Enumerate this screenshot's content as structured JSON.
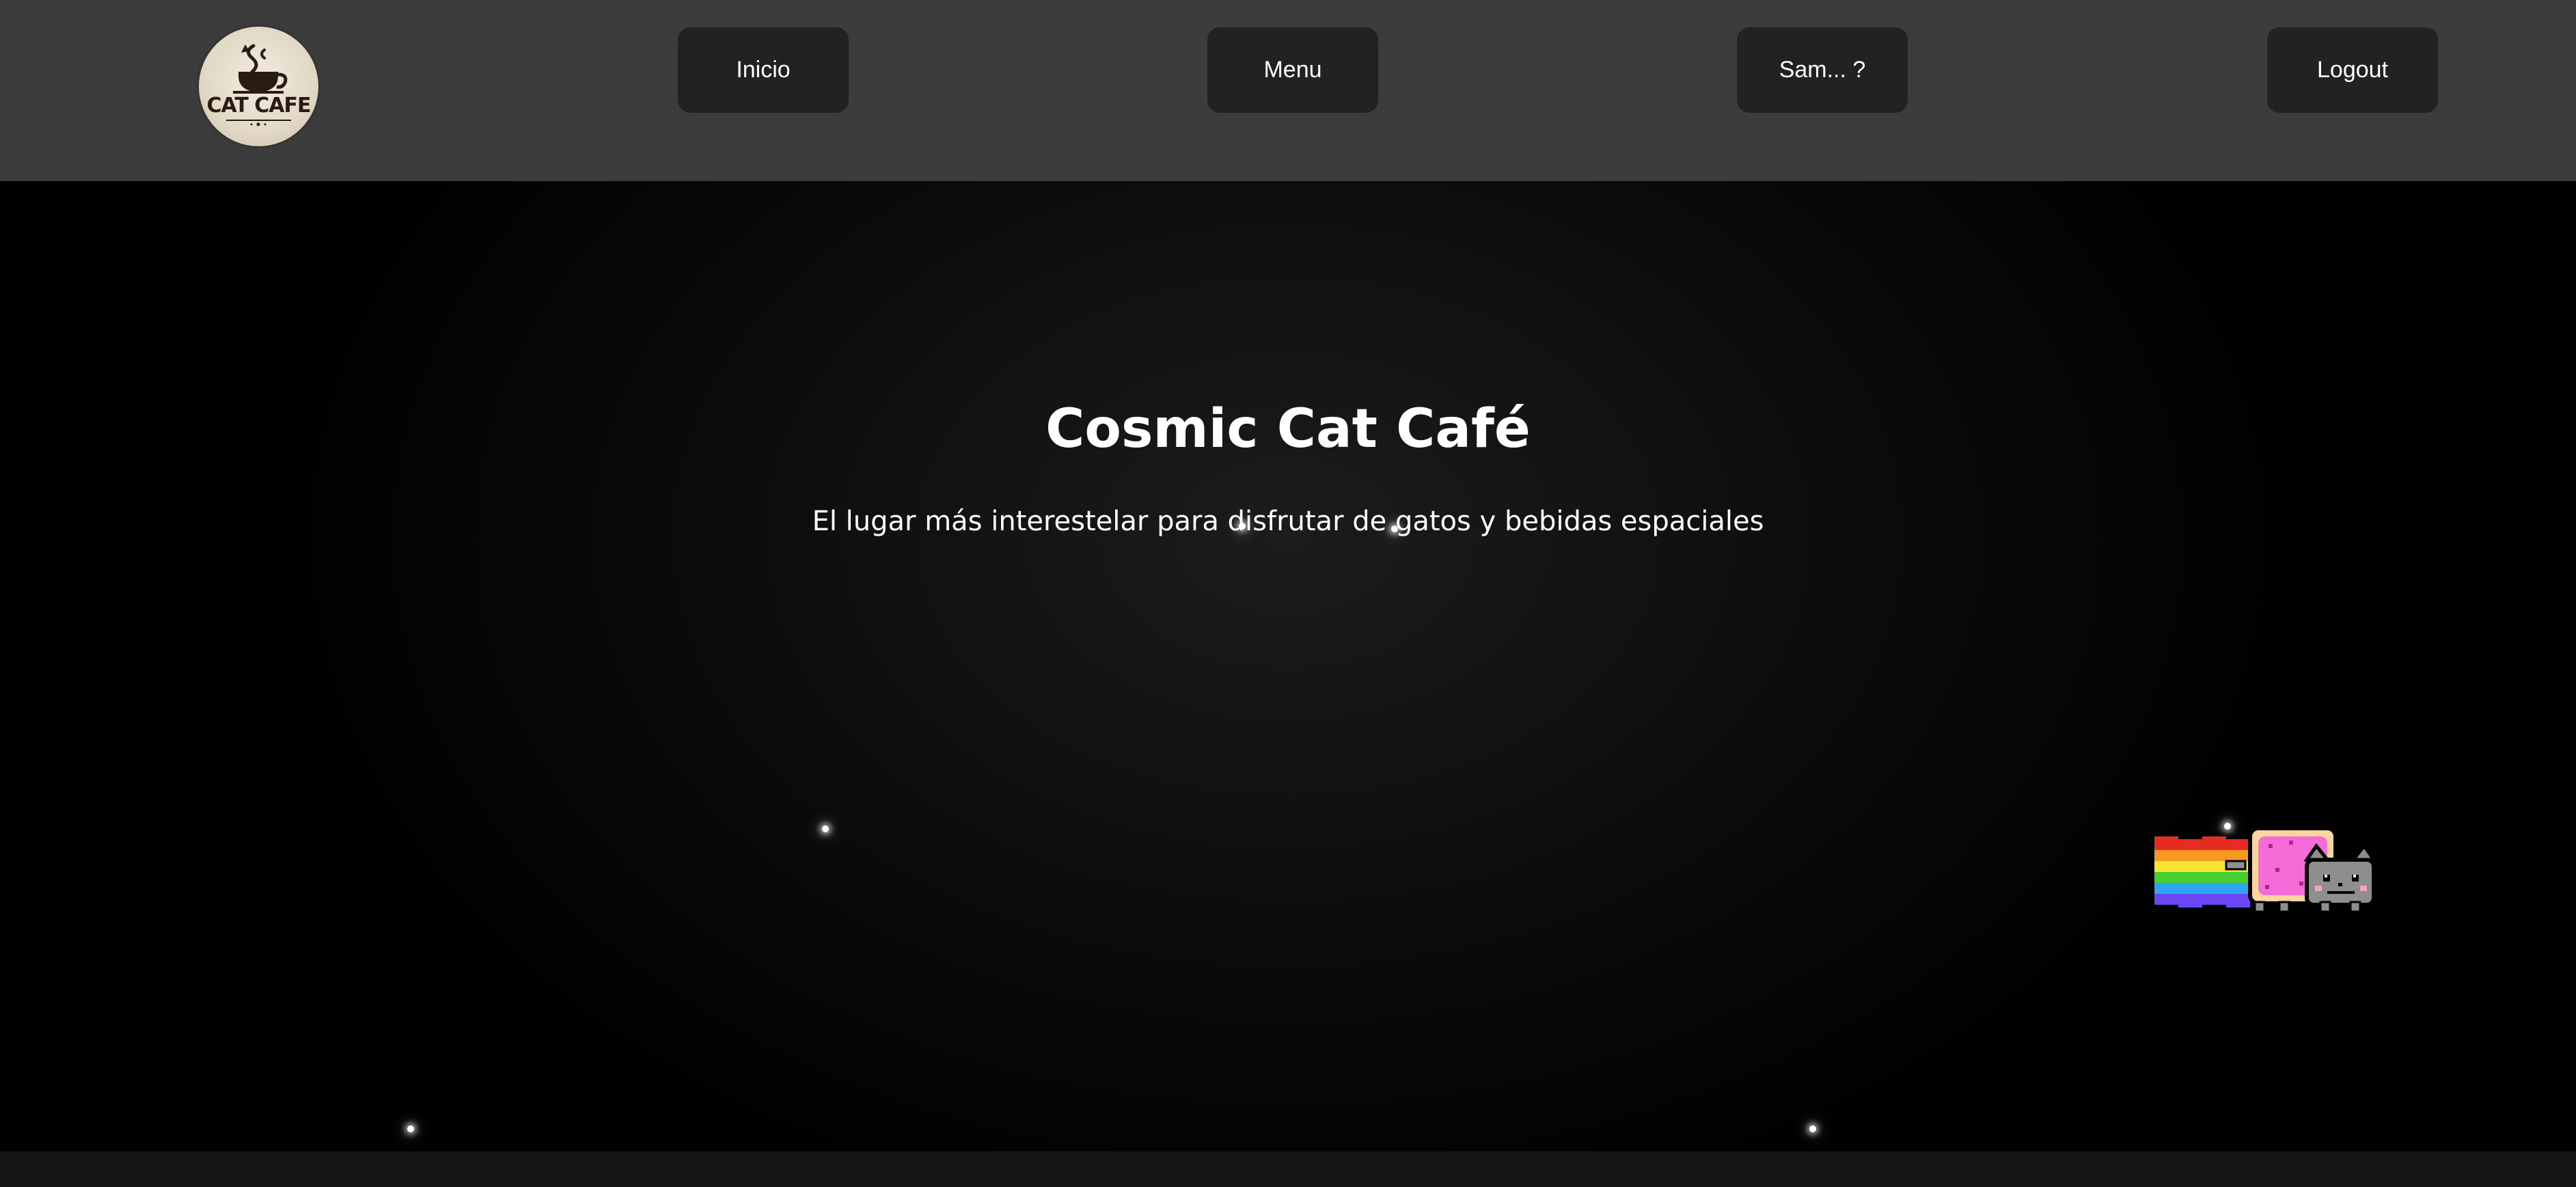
{
  "navbar": {
    "logo": {
      "icon": "cat-cafe-logo-icon",
      "text": "CAT CAFE"
    },
    "buttons": [
      {
        "label": "Inicio"
      },
      {
        "label": "Menu"
      },
      {
        "label": "Sam... ?"
      },
      {
        "label": "Logout"
      }
    ]
  },
  "hero": {
    "title": "Cosmic Cat Café",
    "subtitle": "El lugar más interestelar para disfrutar de gatos y bebidas espaciales",
    "animation": {
      "icon": "nyan-cat-icon"
    }
  },
  "colors": {
    "navbar_bg": "#3c3c3c",
    "button_bg": "#222222",
    "hero_bg": "#000000",
    "text": "#ffffff"
  }
}
